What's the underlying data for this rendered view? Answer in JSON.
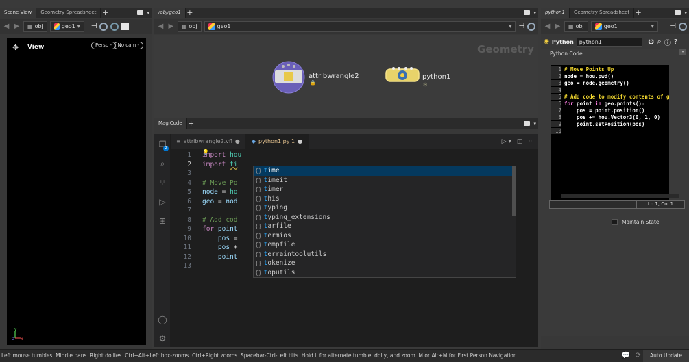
{
  "scene": {
    "tabs": [
      "Scene View",
      "Geometry Spreadsheet"
    ],
    "path": {
      "level1": "obj",
      "level2": "geo1"
    },
    "view_label": "View",
    "persp": "Persp -",
    "cam": "No cam -",
    "axis": {
      "y": "y",
      "z": "z",
      "x": "x"
    }
  },
  "network": {
    "tab": "/obj/geo1",
    "path": {
      "level1": "obj",
      "level2": "geo1"
    },
    "watermark": "Geometry",
    "nodes": [
      {
        "label": "attribwrangle2"
      },
      {
        "label": "python1"
      }
    ]
  },
  "magicode": {
    "tab": "MagiCode",
    "file_tabs": [
      {
        "label": "attribwrangle2.vfl"
      },
      {
        "label": "python1.py 1"
      }
    ],
    "badge": "2",
    "line_numbers": [
      "1",
      "2",
      "3",
      "4",
      "5",
      "6",
      "7",
      "8",
      "9",
      "10",
      "11",
      "12",
      "13"
    ],
    "suggestions": [
      "time",
      "timeit",
      "timer",
      "this",
      "typing",
      "typing_extensions",
      "tarfile",
      "termios",
      "tempfile",
      "terraintoolutils",
      "tokenize",
      "toputils"
    ]
  },
  "python_pane": {
    "tabs": [
      "python1",
      "Geometry Spreadsheet"
    ],
    "path": {
      "level1": "obj",
      "level2": "geo1"
    },
    "type_label": "Python",
    "node_name": "python1",
    "section_label": "Python Code",
    "line_numbers": [
      "1",
      "2",
      "3",
      "4",
      "5",
      "6",
      "7",
      "8",
      "9",
      "10"
    ],
    "cursor_pos": "Ln 1, Col 1",
    "maintain_state": "Maintain State"
  },
  "status": {
    "message": "Left mouse tumbles. Middle pans. Right dollies. Ctrl+Alt+Left box-zooms. Ctrl+Right zooms. Spacebar-Ctrl-Left tilts. Hold L for alternate tumble, dolly, and zoom. M or Alt+M for First Person Navigation.",
    "auto_update": "Auto Update"
  }
}
